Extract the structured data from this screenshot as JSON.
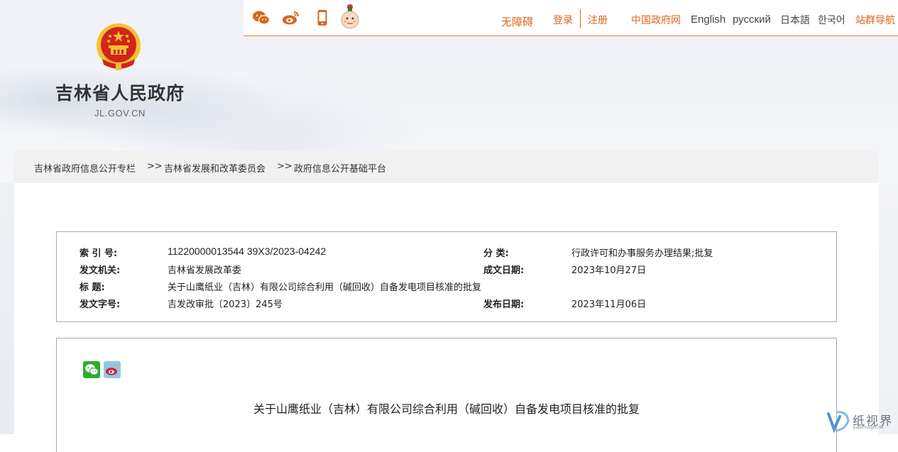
{
  "header": {
    "social_icons": [
      "wechat-icon",
      "weibo-icon",
      "mobile-icon",
      "mascot-icon"
    ],
    "nav": {
      "accessibility": "无障碍",
      "login": "登录",
      "register": "注册",
      "central_gov": "中国政府网",
      "english": "English",
      "russian": "русский",
      "japanese": "日本語",
      "korean": "한국어",
      "sitemap": "站群导航"
    },
    "site_title": "吉林省人民政府",
    "site_domain": "JL.GOV.CN"
  },
  "breadcrumb": {
    "items": [
      "吉林省政府信息公开专栏",
      "吉林省发展和改革委员会",
      "政府信息公开基础平台"
    ],
    "separator": ">>"
  },
  "meta": {
    "index_label": "索 引 号:",
    "index_value": "11220000013544 39X3/2023-04242",
    "category_label": "分  类:",
    "category_value": "行政许可和办事服务办理结果;批复",
    "issuer_label": "发文机关:",
    "issuer_value": "吉林省发展改革委",
    "date_written_label": "成文日期:",
    "date_written_value": "2023年10月27日",
    "title_label": "标    题:",
    "title_value": "关于山鹰纸业（吉林）有限公司综合利用（碱回收）自备发电项目核准的批复",
    "doc_no_label": "发文字号:",
    "doc_no_value": "吉发改审批〔2023〕245号",
    "publish_date_label": "发布日期:",
    "publish_date_value": "2023年11月06日"
  },
  "article": {
    "share_icons": [
      "wechat-share-icon",
      "weibo-share-icon"
    ],
    "title": "关于山鹰纸业（吉林）有限公司综合利用（碱回收）自备发电项目核准的批复"
  },
  "watermark": {
    "text": "纸视界",
    "sub": "paperinsight.net"
  },
  "colors": {
    "accent": "#d8661e",
    "emblem_red": "#d4231c",
    "emblem_gold": "#f2c230"
  }
}
